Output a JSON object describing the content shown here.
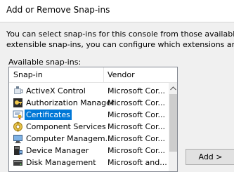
{
  "window": {
    "title": "Add or Remove Snap-ins"
  },
  "description": {
    "line1": "You can select snap-ins for this console from those available on you",
    "line2": "extensible snap-ins, you can configure which extensions are enable"
  },
  "available": {
    "label": "Available snap-ins:",
    "columns": {
      "snapin": "Snap-in",
      "vendor": "Vendor"
    },
    "rows": [
      {
        "name": "ActiveX Control",
        "vendor": "Microsoft Cor...",
        "icon": "activex-control-icon"
      },
      {
        "name": "Authorization Manager",
        "vendor": "Microsoft Cor...",
        "icon": "authorization-manager-icon"
      },
      {
        "name": "Certificates",
        "vendor": "Microsoft Cor...",
        "icon": "certificates-icon",
        "selected": true
      },
      {
        "name": "Component Services",
        "vendor": "Microsoft Cor...",
        "icon": "component-services-icon"
      },
      {
        "name": "Computer Managem...",
        "vendor": "Microsoft Cor...",
        "icon": "computer-management-icon"
      },
      {
        "name": "Device Manager",
        "vendor": "Microsoft Cor...",
        "icon": "device-manager-icon"
      },
      {
        "name": "Disk Management",
        "vendor": "Microsoft and...",
        "icon": "disk-management-icon"
      }
    ]
  },
  "buttons": {
    "add": "Add >"
  },
  "colors": {
    "selection": "#0078d7",
    "window_bg": "#f0f0f0"
  }
}
